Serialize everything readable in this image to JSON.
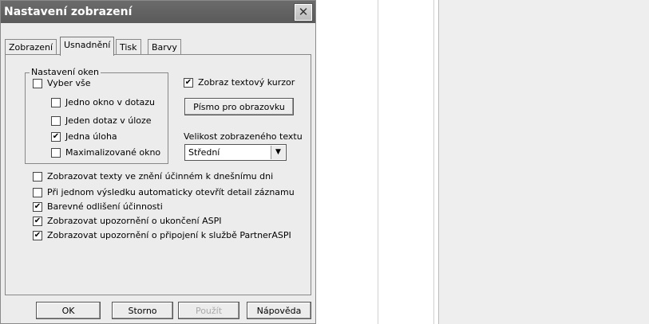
{
  "window": {
    "title": "Nastavení zobrazení"
  },
  "tabs": [
    {
      "label": "Zobrazení"
    },
    {
      "label": "Usnadnění"
    },
    {
      "label": "Tisk"
    },
    {
      "label": "Barvy"
    }
  ],
  "group": {
    "title": "Nastavení oken",
    "items": [
      {
        "label": "Vyber vše",
        "checked": false
      },
      {
        "label": "Jedno okno v dotazu",
        "checked": false
      },
      {
        "label": "Jeden dotaz v úloze",
        "checked": false
      },
      {
        "label": "Jedna úloha",
        "checked": true
      },
      {
        "label": "Maximalizované okno",
        "checked": false
      }
    ]
  },
  "right": {
    "cursor_label": "Zobraz textový kurzor",
    "cursor_checked": true,
    "font_button": "Písmo pro obrazovku",
    "size_label": "Velikost zobrazeného textu",
    "size_value": "Střední"
  },
  "options": [
    {
      "label": "Zobrazovat texty ve znění účinném k dnešnímu dni",
      "checked": false
    },
    {
      "label": "Při jednom výsledku automaticky otevřít detail záznamu",
      "checked": false
    },
    {
      "label": "Barevné odlišení účinnosti",
      "checked": true
    },
    {
      "label": "Zobrazovat upozornění o ukončení ASPI",
      "checked": true
    },
    {
      "label": "Zobrazovat upozornění o připojení k službě PartnerASPI",
      "checked": true
    }
  ],
  "buttons": {
    "ok": "OK",
    "cancel": "Storno",
    "apply": "Použít",
    "help": "Nápověda"
  },
  "check_mark": "✔",
  "close_glyph": "✕",
  "dropdown_glyph": "▼"
}
